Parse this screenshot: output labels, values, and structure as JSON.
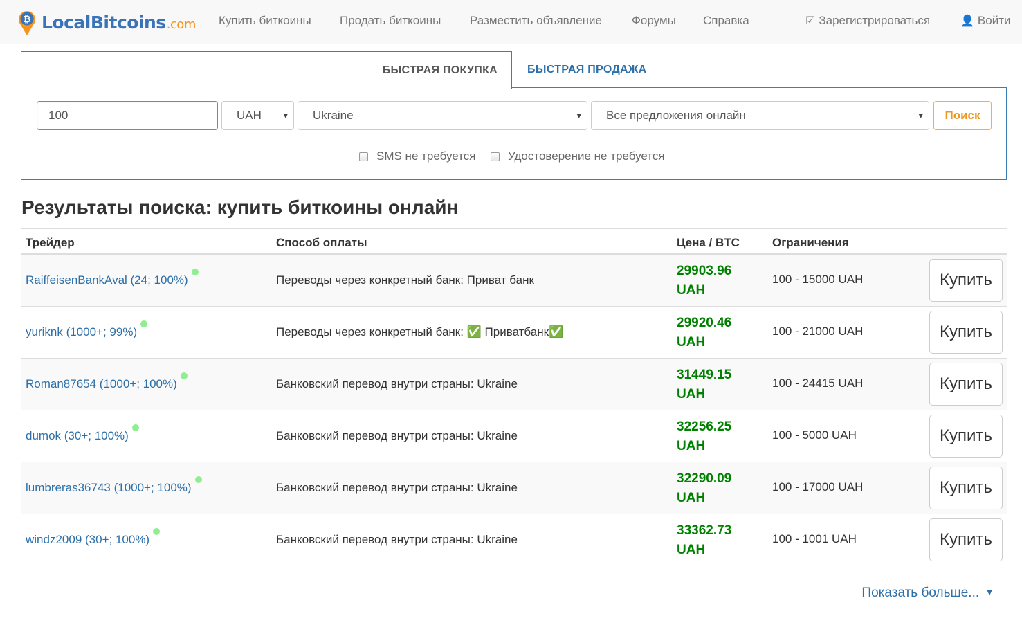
{
  "brand": {
    "name": "LocalBitcoins",
    "domain": ".com"
  },
  "nav": {
    "buy": "Купить биткоины",
    "sell": "Продать биткоины",
    "post_ad": "Разместить объявление",
    "forums": "Форумы",
    "help": "Справка",
    "register": "Зарегистрироваться",
    "login": "Войти"
  },
  "tabs": {
    "quick_buy": "БЫСТРАЯ ПОКУПКА",
    "quick_sell": "БЫСТРАЯ ПРОДАЖА"
  },
  "search": {
    "amount": "100",
    "currency": "UAH",
    "country": "Ukraine",
    "offers": "Все предложения онлайн",
    "button": "Поиск",
    "sms_not_required": "SMS не требуется",
    "id_not_required": "Удостоверение не требуется"
  },
  "results": {
    "title": "Результаты поиска: купить биткоины онлайн",
    "headers": {
      "trader": "Трейдер",
      "payment": "Способ оплаты",
      "price": "Цена / BTC",
      "limits": "Ограничения"
    },
    "buy_label": "Купить",
    "rows": [
      {
        "trader": "RaiffeisenBankAval (24; 100%)",
        "payment": "Переводы через конкретный банк: Приват банк",
        "price": "29903.96",
        "currency": "UAH",
        "limits": "100 - 15000 UAH"
      },
      {
        "trader": "yuriknk (1000+; 99%)",
        "payment": "Переводы через конкретный банк: ✅ Приватбанк✅",
        "price": "29920.46",
        "currency": "UAH",
        "limits": "100 - 21000 UAH"
      },
      {
        "trader": "Roman87654 (1000+; 100%)",
        "payment": "Банковский перевод внутри страны: Ukraine",
        "price": "31449.15",
        "currency": "UAH",
        "limits": "100 - 24415 UAH"
      },
      {
        "trader": "dumok (30+; 100%)",
        "payment": "Банковский перевод внутри страны: Ukraine",
        "price": "32256.25",
        "currency": "UAH",
        "limits": "100 - 5000 UAH"
      },
      {
        "trader": "lumbreras36743 (1000+; 100%)",
        "payment": "Банковский перевод внутри страны: Ukraine",
        "price": "32290.09",
        "currency": "UAH",
        "limits": "100 - 17000 UAH"
      },
      {
        "trader": "windz2009 (30+; 100%)",
        "payment": "Банковский перевод внутри страны: Ukraine",
        "price": "33362.73",
        "currency": "UAH",
        "limits": "100 - 1001 UAH"
      }
    ],
    "show_more": "Показать больше..."
  }
}
